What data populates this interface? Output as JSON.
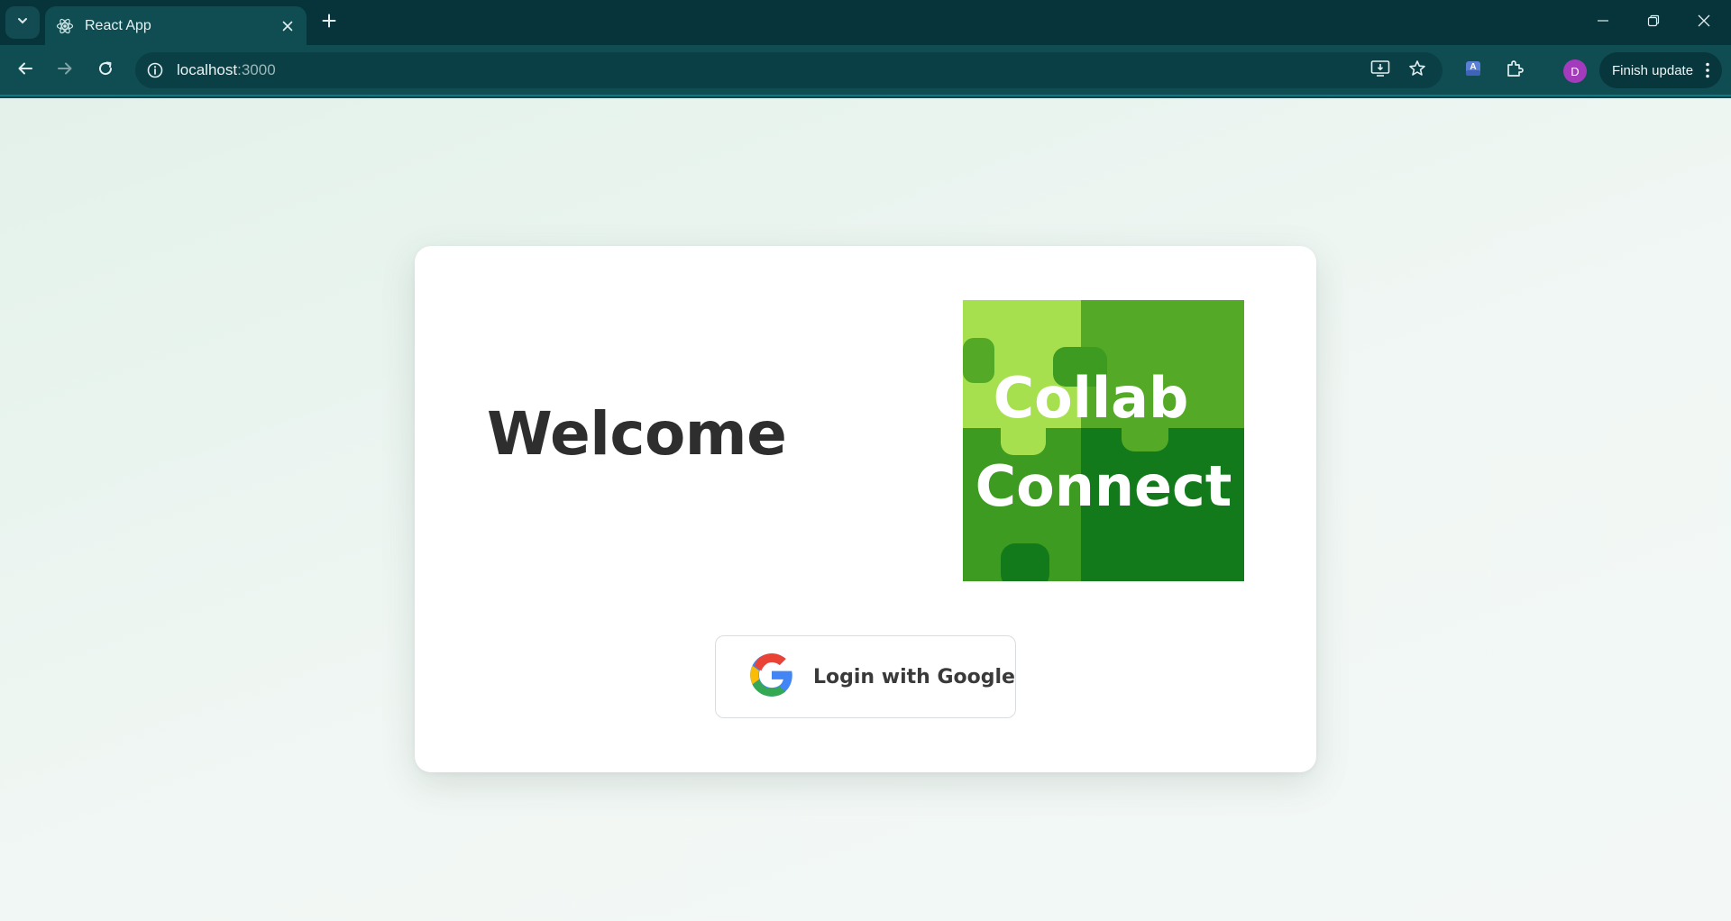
{
  "browser": {
    "tab": {
      "title": "React App",
      "favicon": "react-icon"
    },
    "address": {
      "host": "localhost",
      "port": ":3000"
    },
    "profile_initial": "D",
    "finish_update_label": "Finish update"
  },
  "page": {
    "welcome_text": "Welcome",
    "logo": {
      "line1": "Collab",
      "line2": "Connect"
    },
    "login_button_label": "Login with Google"
  },
  "colors": {
    "logo_light": "#a6e04f",
    "logo_mid": "#54aa27",
    "logo_dark": "#127a1a",
    "logo_mid2": "#3e9b21"
  }
}
